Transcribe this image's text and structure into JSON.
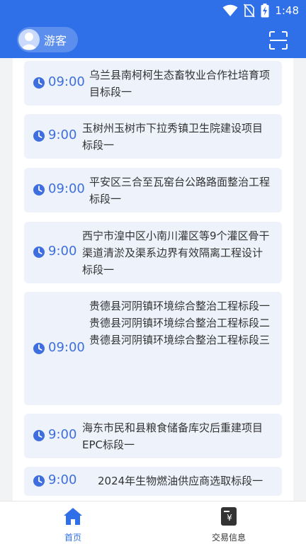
{
  "status_bar": {
    "time": "1:48"
  },
  "header": {
    "guest_label": "游客"
  },
  "schedule": {
    "items": [
      {
        "time": "09:00",
        "titles": [
          "乌兰县南柯柯生态畜牧业合作社培育项目标段一"
        ]
      },
      {
        "time": "9:00",
        "titles": [
          "玉树州玉树市下拉秀镇卫生院建设项目标段一"
        ]
      },
      {
        "time": "09:00",
        "titles": [
          "平安区三合至瓦窑台公路路面整治工程标段一"
        ]
      },
      {
        "time": "9:00",
        "titles": [
          "西宁市湟中区小南川灌区等9个灌区骨干渠道清淤及渠系边界有效隔离工程设计标段一"
        ]
      },
      {
        "time": "09:00",
        "titles": [
          "贵德县河阴镇环境综合整治工程标段一",
          "贵德县河阴镇环境综合整治工程标段二",
          "贵德县河阴镇环境综合整治工程标段三"
        ]
      },
      {
        "time": "9:00",
        "titles": [
          "海东市民和县粮食储备库灾后重建项目 EPC标段一"
        ]
      },
      {
        "time": "9:00",
        "titles": [
          "2024年生物燃油供应商选取标段一"
        ]
      }
    ]
  },
  "bottom_nav": {
    "home_label": "首页",
    "trade_label": "交易信息",
    "active_color": "#2f6fe8",
    "inactive_color": "#333333"
  }
}
